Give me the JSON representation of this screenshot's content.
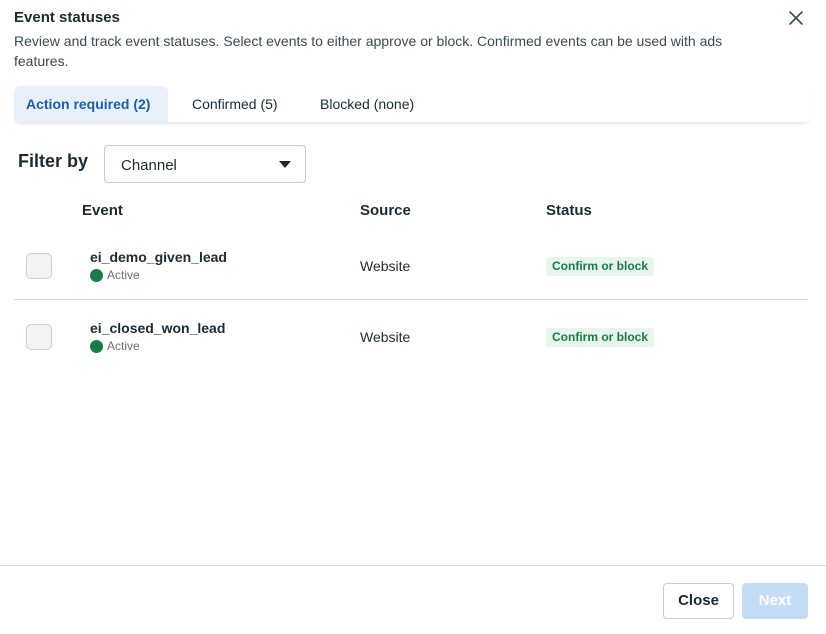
{
  "dialog": {
    "title": "Event statuses",
    "description": "Review and track event statuses. Select events to either approve or block. Confirmed events can be used with ads features."
  },
  "tabs": [
    {
      "label": "Action required (2)",
      "active": true
    },
    {
      "label": "Confirmed (5)",
      "active": false
    },
    {
      "label": "Blocked (none)",
      "active": false
    }
  ],
  "filter": {
    "label": "Filter by",
    "selected": "Channel"
  },
  "table": {
    "headers": {
      "event": "Event",
      "source": "Source",
      "status": "Status"
    },
    "rows": [
      {
        "name": "ei_demo_given_lead",
        "state": "Active",
        "source": "Website",
        "status": "Confirm or block"
      },
      {
        "name": "ei_closed_won_lead",
        "state": "Active",
        "source": "Website",
        "status": "Confirm or block"
      }
    ]
  },
  "footer": {
    "close_label": "Close",
    "next_label": "Next"
  },
  "colors": {
    "accent": "#1d5fa8",
    "active_tab_bg": "#e8f1fb",
    "status_green": "#1b7a4b",
    "disabled_button": "#c5dcf5"
  }
}
